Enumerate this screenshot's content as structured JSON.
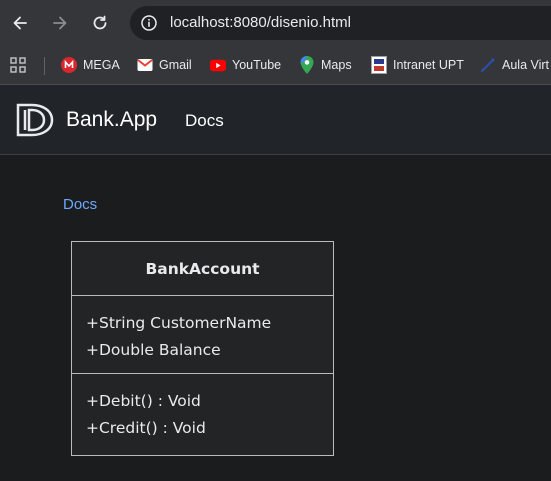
{
  "browser": {
    "url": "localhost:8080/disenio.html",
    "bookmarks": [
      {
        "label": "MEGA",
        "icon": "mega-icon"
      },
      {
        "label": "Gmail",
        "icon": "gmail-icon"
      },
      {
        "label": "YouTube",
        "icon": "youtube-icon"
      },
      {
        "label": "Maps",
        "icon": "maps-icon"
      },
      {
        "label": "Intranet UPT",
        "icon": "intranet-upt-icon"
      },
      {
        "label": "Aula Virt",
        "icon": "aula-virtual-icon"
      }
    ]
  },
  "header": {
    "brand": "Bank.App",
    "nav": [
      "Docs"
    ]
  },
  "content": {
    "breadcrumb": "Docs",
    "uml": {
      "class_name": "BankAccount",
      "attributes": [
        "+String CustomerName",
        "+Double Balance"
      ],
      "methods": [
        "+Debit() : Void",
        "+Credit() : Void"
      ]
    }
  }
}
